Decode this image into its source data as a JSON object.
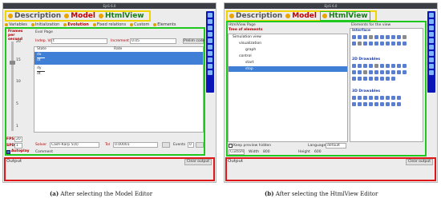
{
  "panel_a": {
    "window_title": "EjsS 6.0",
    "tabs": [
      "Description",
      "Model",
      "HtmlView"
    ],
    "subtabs": [
      "Variables",
      "Initialization",
      "Evolution",
      "Fixed relations",
      "Custom",
      "Elements"
    ],
    "frames_label": "Frames per second",
    "slider_ticks": [
      "20",
      "15",
      "10",
      "5",
      "1"
    ],
    "page_tab": "Evol Page",
    "indep_var_label": "Indep. Var",
    "indep_var_value": "t",
    "increment_label": "Increment",
    "increment_value": "0.05",
    "prelim_button": "Prelim code",
    "table_headers": [
      "State",
      "Rate"
    ],
    "table_rows": [
      [
        "dx",
        "dt"
      ],
      [
        "dy",
        "dt"
      ]
    ],
    "fps_label": "FPS",
    "fps_value": "20",
    "spd_label": "SPD",
    "spd_value": "1",
    "autoplay_label": "Autoplay",
    "solver_label": "Solver",
    "solver_value": "Cash-Karp 5(4)",
    "tol_label": "Tol",
    "tol_value": "0.00001",
    "events_label": "Events",
    "events_value": "0",
    "comment_label": "Comment",
    "output_label": "Output",
    "clear_button": "Clear output",
    "caption_tag": "(a)",
    "caption_text": "After selecting the Model Editor"
  },
  "panel_b": {
    "window_title": "EjsS 6.0",
    "tabs": [
      "Description",
      "Model",
      "HtmlView"
    ],
    "page_label": "HtmlView Page",
    "tree_title": "Tree of elements",
    "tree_items": [
      "Simulation view",
      "visualization",
      "graph",
      "control",
      "start",
      "stop"
    ],
    "palette_title": "Elements for the view",
    "palette_sections": [
      "Interface",
      "2D Drawables",
      "3D Drawables"
    ],
    "keep_preview": "Keep preview hidden",
    "language_label": "Language",
    "language_value": "default",
    "custom_label": "Custom",
    "width_label": "Width",
    "width_value": "800",
    "height_label": "Height",
    "height_value": "600",
    "output_label": "Output",
    "clear_button": "Clear output",
    "caption_tag": "(b)",
    "caption_text": "After selecting the HtmlView Editor"
  },
  "colors": {
    "yellow_highlight": "#f2d400",
    "green_highlight": "#1ec81e",
    "red_highlight": "#e01515",
    "blue_highlight": "#0a15b8"
  }
}
